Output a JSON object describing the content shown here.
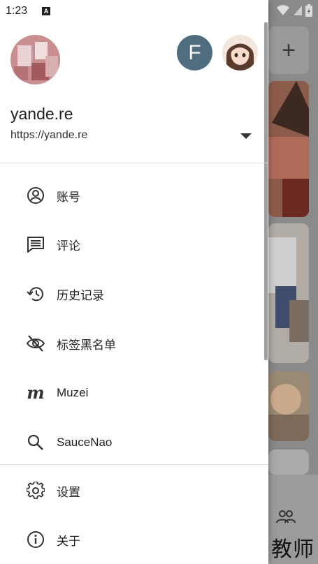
{
  "status_bar": {
    "time": "1:23",
    "notification_badge": "A"
  },
  "drawer": {
    "profile": {
      "title": "yande.re",
      "url": "https://yande.re",
      "alt_avatar_letter": "F"
    },
    "menu_primary": [
      {
        "label": "账号",
        "icon": "account-circle-icon"
      },
      {
        "label": "评论",
        "icon": "comment-icon"
      },
      {
        "label": "历史记录",
        "icon": "history-icon"
      },
      {
        "label": "标签黑名单",
        "icon": "eye-off-icon"
      },
      {
        "label": "Muzei",
        "icon": "muzei-icon"
      },
      {
        "label": "SauceNao",
        "icon": "search-icon"
      }
    ],
    "menu_secondary": [
      {
        "label": "设置",
        "icon": "gear-icon"
      },
      {
        "label": "关于",
        "icon": "info-icon"
      }
    ]
  },
  "background": {
    "add_symbol": "+",
    "watermark": "教师"
  },
  "colors": {
    "drawer_bg": "#ffffff",
    "avatar_f_bg": "#4f6d7f",
    "scrim": "#8a8a8a"
  }
}
